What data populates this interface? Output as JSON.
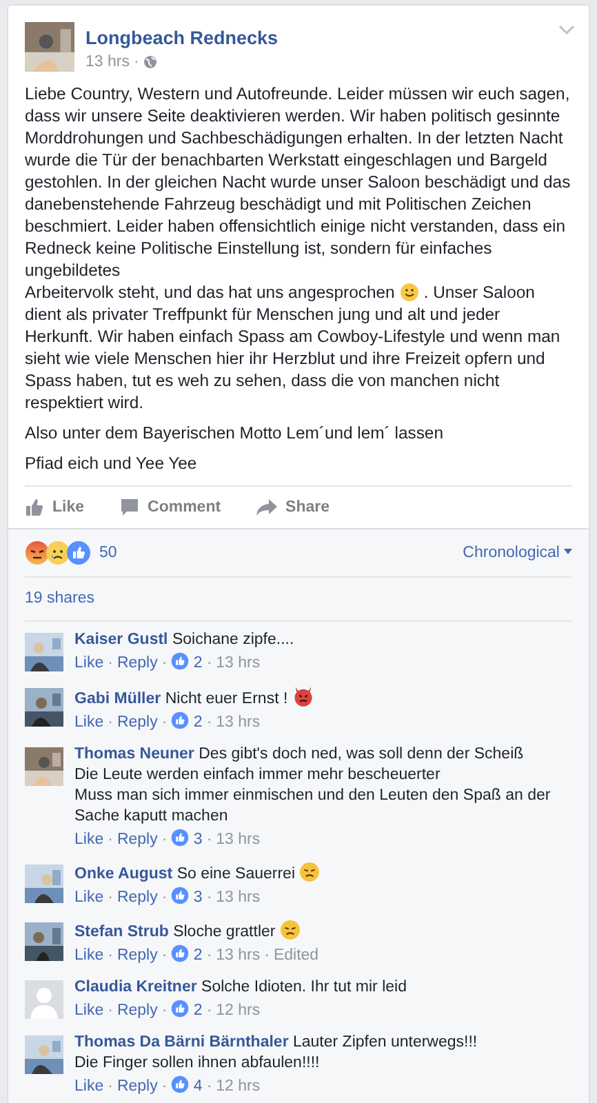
{
  "post": {
    "page_name": "Longbeach Rednecks",
    "page_avatar": {
      "kind": "picture"
    },
    "time": "13 hrs",
    "separator": "·",
    "paragraphs": [
      {
        "blocks": [
          {
            "kind": "text",
            "text": "Liebe Country, Western und Autofreunde. Leider müssen wir euch sagen, dass wir unsere Seite deaktivieren werden. Wir haben politisch gesinnte Morddrohungen und Sachbeschädigungen erhalten. In der letzten Nacht wurde die Tür der benachbarten Werkstatt eingeschlagen und Bargeld gestohlen. In der gleichen Nacht wurde unser Saloon beschädigt und das danebenstehende Fahrzeug beschädigt und mit Politischen Zeichen beschmiert. Leider haben offensichtlich einige nicht verstanden, dass ein Redneck keine Politische Einstellung ist, sondern für einfaches ungebildetes"
          },
          {
            "kind": "emoji_line",
            "before": "Arbeitervolk steht, und das hat uns angesprochen",
            "emoji": {
              "kind": "smile"
            },
            "after": ". Unser Saloon"
          },
          {
            "kind": "text",
            "text": "dient als privater Treffpunkt für Menschen jung und alt und jeder Herkunft. Wir haben einfach Spass am Cowboy-Lifestyle und wenn man sieht wie viele Menschen hier ihr Herzblut und ihre Freizeit opfern und Spass haben, tut es weh zu sehen, dass die von manchen nicht respektiert wird."
          }
        ]
      },
      {
        "text": "Also unter dem Bayerischen Motto Lem´und lem´ lassen"
      },
      {
        "text": "Pfiad eich und Yee Yee"
      }
    ],
    "actions": [
      {
        "kind": "like",
        "label": "Like"
      },
      {
        "kind": "comment",
        "label": "Comment"
      },
      {
        "kind": "share",
        "label": "Share"
      }
    ]
  },
  "summary": {
    "reactions": [
      {
        "kind": "angry"
      },
      {
        "kind": "sad"
      },
      {
        "kind": "like"
      }
    ],
    "count": "50",
    "order": "Chronological",
    "shares": "19 shares"
  },
  "comments": {
    "separator": "·",
    "items": [
      {
        "avatar": {
          "kind": "picture"
        },
        "name": "Kaiser Gustl",
        "lines": [
          "Soichane zipfe...."
        ],
        "like": "Like",
        "reply": "Reply",
        "likes": "2",
        "time": "13 hrs"
      },
      {
        "avatar": {
          "kind": "picture"
        },
        "name": "Gabi Müller",
        "lines": [
          "Nicht euer Ernst !"
        ],
        "emoji": {
          "kind": "devil"
        },
        "like": "Like",
        "reply": "Reply",
        "likes": "2",
        "time": "13 hrs"
      },
      {
        "avatar": {
          "kind": "picture"
        },
        "name": "Thomas Neuner",
        "lines": [
          "Des gibt's doch ned, was soll denn der Scheiß",
          "Die Leute werden einfach immer mehr bescheuerter",
          "Muss man sich immer einmischen und den Leuten den Spaß an der Sache kaputt machen"
        ],
        "like": "Like",
        "reply": "Reply",
        "likes": "3",
        "time": "13 hrs"
      },
      {
        "avatar": {
          "kind": "picture"
        },
        "name": "Onke August",
        "lines": [
          "So eine Sauerrei"
        ],
        "emoji": {
          "kind": "angry"
        },
        "like": "Like",
        "reply": "Reply",
        "likes": "3",
        "time": "13 hrs"
      },
      {
        "avatar": {
          "kind": "picture"
        },
        "name": "Stefan Strub",
        "lines": [
          "Sloche grattler"
        ],
        "emoji": {
          "kind": "angry"
        },
        "like": "Like",
        "reply": "Reply",
        "likes": "2",
        "time": "13 hrs",
        "edited": "Edited"
      },
      {
        "avatar": {
          "kind": "silhouette"
        },
        "name": "Claudia Kreitner",
        "lines": [
          "Solche Idioten. Ihr tut mir leid"
        ],
        "like": "Like",
        "reply": "Reply",
        "likes": "2",
        "time": "12 hrs"
      },
      {
        "avatar": {
          "kind": "picture"
        },
        "name": "Thomas Da Bärni Bärnthaler",
        "lines": [
          "Lauter Zipfen unterwegs!!!",
          "Die Finger sollen ihnen abfaulen!!!!"
        ],
        "like": "Like",
        "reply": "Reply",
        "likes": "4",
        "time": "12 hrs"
      }
    ]
  }
}
